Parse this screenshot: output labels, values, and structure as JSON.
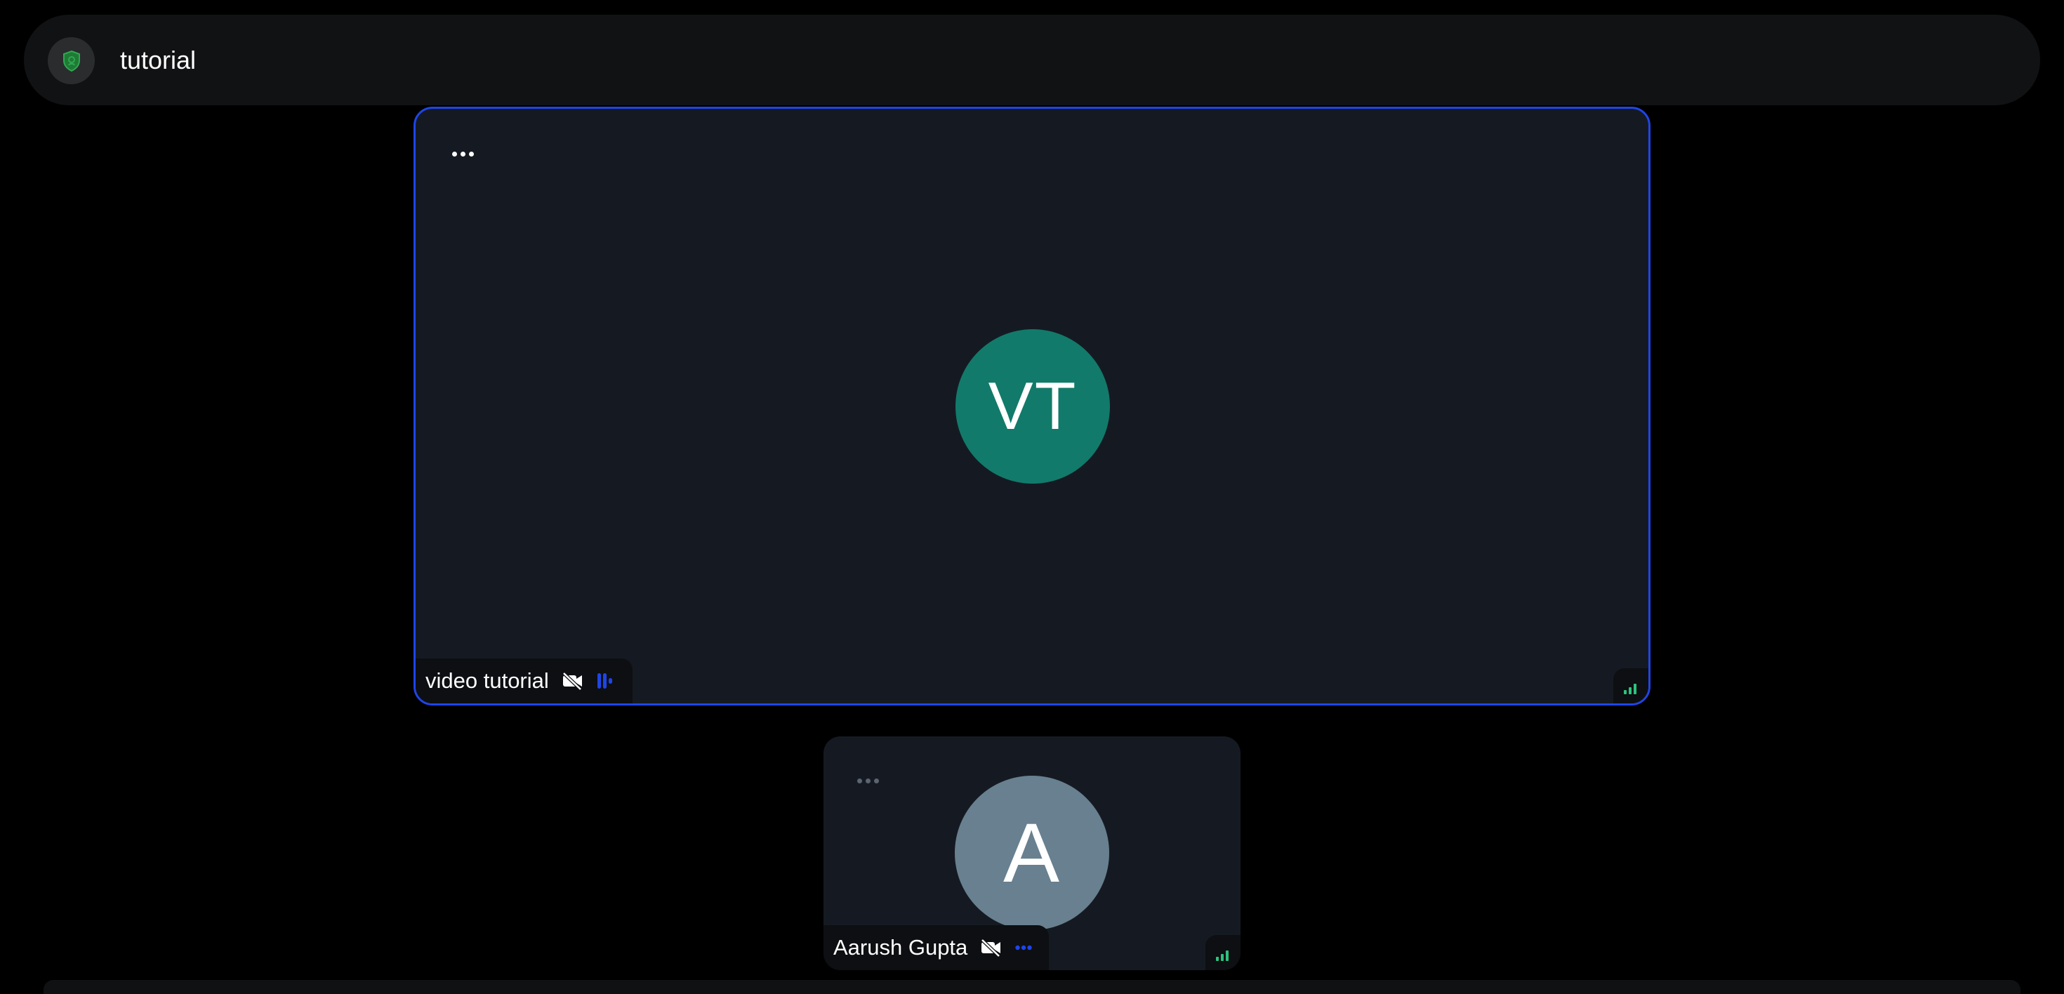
{
  "header": {
    "room_name": "tutorial",
    "badge_icon": "shield-icon",
    "badge_color": "#2fa84f"
  },
  "main_tile": {
    "initials": "VT",
    "participant_name": "video tutorial",
    "avatar_color": "#127a6a",
    "border_color": "#1f45e6",
    "camera_icon": "camera-off-icon",
    "audio_icon": "audio-level-icon",
    "menu_icon": "more-options-icon",
    "signal_icon": "network-signal-icon",
    "signal_color": "#2ec27e"
  },
  "secondary_tile": {
    "initials": "A",
    "participant_name": "Aarush Gupta",
    "avatar_color": "#68808f",
    "camera_icon": "camera-off-icon",
    "audio_icon": "audio-inactive-icon",
    "menu_icon": "more-options-icon",
    "signal_icon": "network-signal-icon",
    "signal_color": "#2ec27e"
  }
}
